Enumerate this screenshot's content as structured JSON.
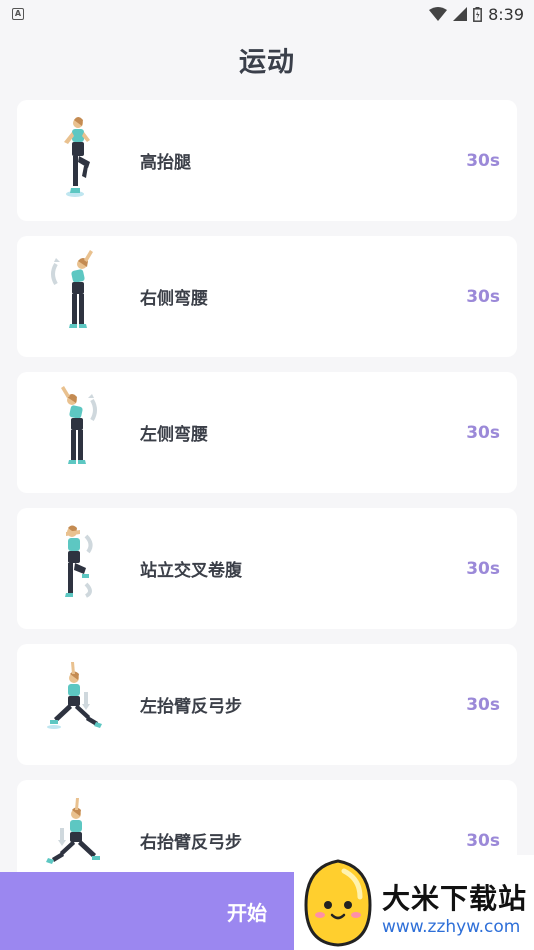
{
  "status_bar": {
    "time": "8:39",
    "icons": [
      "accessibility-a-icon",
      "wifi-icon",
      "signal-icon",
      "battery-icon"
    ]
  },
  "header": {
    "title": "运动"
  },
  "exercises": [
    {
      "name": "高抬腿",
      "duration": "30s",
      "figure": "high-knee-figure"
    },
    {
      "name": "右侧弯腰",
      "duration": "30s",
      "figure": "right-side-bend-figure"
    },
    {
      "name": "左侧弯腰",
      "duration": "30s",
      "figure": "left-side-bend-figure"
    },
    {
      "name": "站立交叉卷腹",
      "duration": "30s",
      "figure": "standing-cross-crunch-figure"
    },
    {
      "name": "左抬臂反弓步",
      "duration": "30s",
      "figure": "left-reverse-lunge-figure"
    },
    {
      "name": "右抬臂反弓步",
      "duration": "30s",
      "figure": "right-reverse-lunge-figure"
    }
  ],
  "start_button": {
    "label": "开始"
  },
  "watermark": {
    "text": "大米下载站",
    "url": "www.zzhyw.com"
  },
  "colors": {
    "accent": "#9b87f0",
    "duration": "#9b89d8",
    "background": "#f6f6f8"
  }
}
